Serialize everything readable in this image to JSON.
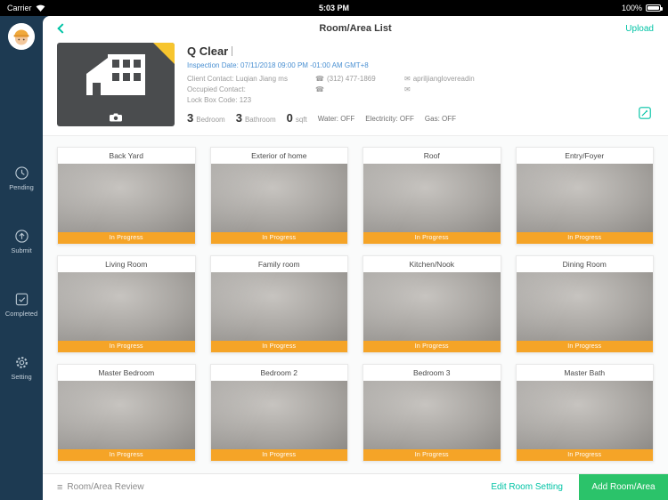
{
  "colors": {
    "accent_teal": "#00C3A5",
    "accent_green": "#2BC36A",
    "status_orange": "#F5A427",
    "sidebar_navy": "#1D3A52",
    "date_blue": "#4A90D2"
  },
  "status_bar": {
    "carrier": "Carrier",
    "time": "5:03 PM",
    "battery_percent": "100%"
  },
  "sidebar": {
    "items": [
      {
        "label": "Pending"
      },
      {
        "label": "Submit"
      },
      {
        "label": "Completed"
      },
      {
        "label": "Setting"
      }
    ]
  },
  "header": {
    "title": "Room/Area List",
    "upload_label": "Upload"
  },
  "property": {
    "name": "Q Clear",
    "inspection_date": "Inspection Date: 07/11/2018 09:00 PM -01:00 AM GMT+8",
    "client_contact": "Client Contact: Luqian Jiang  ms",
    "client_phone": "(312) 477-1869",
    "client_email": "apriljianglovereadin",
    "occupied_contact": "Occupied Contact:",
    "occupied_phone": "",
    "occupied_email": "",
    "lock_box_code": "Lock Box Code: 123",
    "stats": [
      {
        "value": "3",
        "label": "Bedroom"
      },
      {
        "value": "3",
        "label": "Bathroom"
      },
      {
        "value": "0",
        "label": "sqft"
      }
    ],
    "utilities": [
      "Water: OFF",
      "Electricity: OFF",
      "Gas: OFF"
    ]
  },
  "rooms": [
    {
      "name": "Back Yard",
      "status": "In Progress"
    },
    {
      "name": "Exterior of home",
      "status": "In Progress"
    },
    {
      "name": "Roof",
      "status": "In Progress"
    },
    {
      "name": "Entry/Foyer",
      "status": "In Progress"
    },
    {
      "name": "Living Room",
      "status": "In Progress"
    },
    {
      "name": "Family room",
      "status": "In Progress"
    },
    {
      "name": "Kitchen/Nook",
      "status": "In Progress"
    },
    {
      "name": "Dining Room",
      "status": "In Progress"
    },
    {
      "name": "Master Bedroom",
      "status": "In Progress"
    },
    {
      "name": "Bedroom 2",
      "status": "In Progress"
    },
    {
      "name": "Bedroom 3",
      "status": "In Progress"
    },
    {
      "name": "Master Bath",
      "status": "In Progress"
    }
  ],
  "footer": {
    "review_label": "Room/Area Review",
    "edit_room_setting_label": "Edit Room Setting",
    "add_room_label": "Add Room/Area"
  }
}
